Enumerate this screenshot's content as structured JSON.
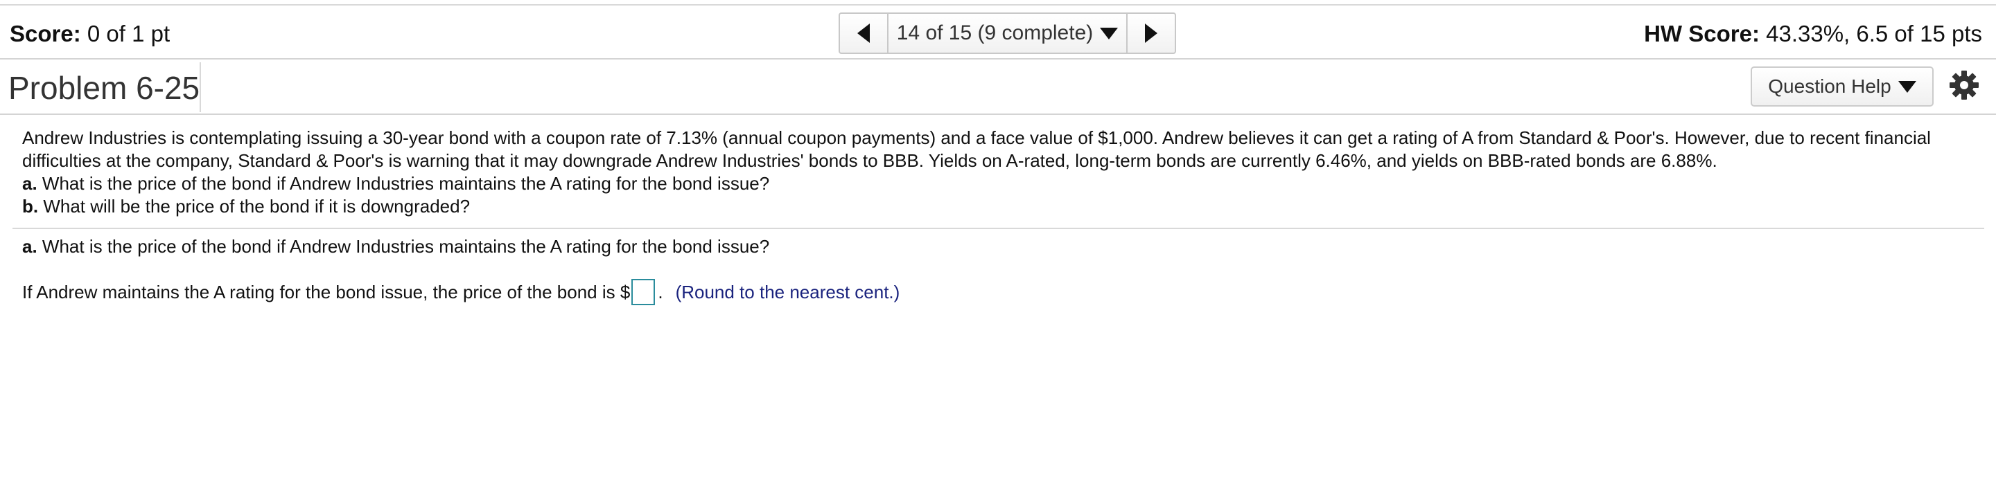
{
  "header": {
    "score_label": "Score:",
    "score_value": "0 of 1 pt",
    "nav_position": "14 of 15 (9 complete)",
    "hw_score_label": "HW Score:",
    "hw_score_value": "43.33%, 6.5 of 15 pts"
  },
  "problem": {
    "title": "Problem 6-25",
    "help_label": "Question Help"
  },
  "question": {
    "intro_line1": "Andrew Industries is contemplating issuing a 30-year bond with a coupon rate of 7.13% (annual coupon payments) and a face value of $1,000. Andrew believes it can get a rating of A from Standard & Poor's. However, due to recent financial",
    "intro_line2": "difficulties at the company, Standard & Poor's is warning that it may downgrade Andrew Industries' bonds to BBB. Yields on A-rated, long-term bonds are currently 6.46%, and yields on BBB-rated bonds are 6.88%.",
    "a_label": "a.",
    "a_text": "What is the price of the bond if Andrew Industries maintains the A rating for the bond issue?",
    "b_label": "b.",
    "b_text": "What will be the price of the bond if it is downgraded?"
  },
  "part_a": {
    "label": "a.",
    "text": "What is the price of the bond if Andrew Industries maintains the A rating for the bond issue?",
    "answer_prefix": "If Andrew maintains the A rating for the bond issue, the price of the bond is $",
    "answer_value": "",
    "answer_suffix": ".",
    "hint": "(Round to the nearest cent.)"
  },
  "icons": {
    "prev": "triangle-left-icon",
    "next": "triangle-right-icon",
    "dropdown": "caret-down-icon",
    "settings": "gear-icon"
  },
  "colors": {
    "hint": "#1a237e",
    "answer_border": "#2a8c9c"
  }
}
